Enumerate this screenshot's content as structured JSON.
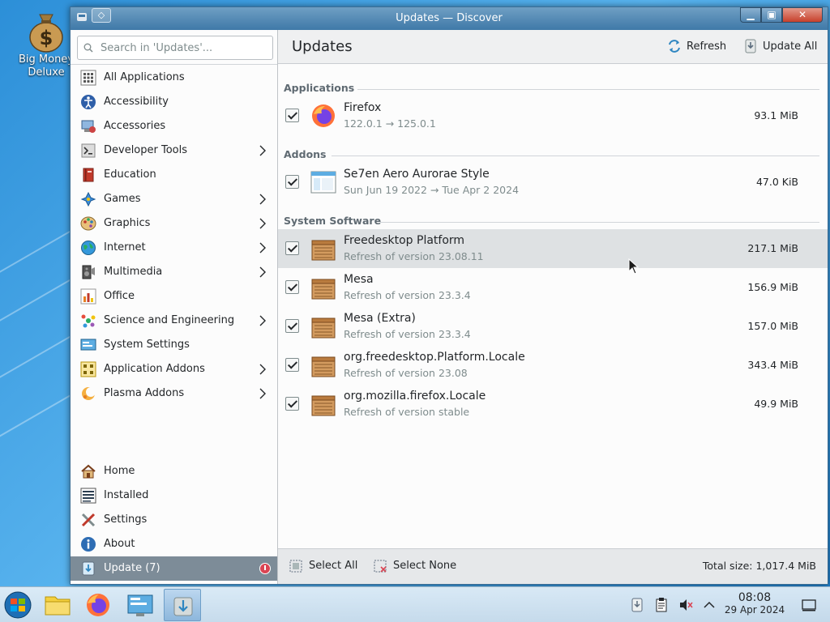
{
  "desktop": {
    "icon_label": "Big Money Deluxe"
  },
  "window": {
    "title": "Updates — Discover"
  },
  "sidebar": {
    "search_placeholder": "Search in 'Updates'...",
    "categories": [
      {
        "label": "All Applications",
        "has_children": false
      },
      {
        "label": "Accessibility",
        "has_children": false
      },
      {
        "label": "Accessories",
        "has_children": false
      },
      {
        "label": "Developer Tools",
        "has_children": true
      },
      {
        "label": "Education",
        "has_children": false
      },
      {
        "label": "Games",
        "has_children": true
      },
      {
        "label": "Graphics",
        "has_children": true
      },
      {
        "label": "Internet",
        "has_children": true
      },
      {
        "label": "Multimedia",
        "has_children": true
      },
      {
        "label": "Office",
        "has_children": false
      },
      {
        "label": "Science and Engineering",
        "has_children": true
      },
      {
        "label": "System Settings",
        "has_children": false
      },
      {
        "label": "Application Addons",
        "has_children": true
      },
      {
        "label": "Plasma Addons",
        "has_children": true
      }
    ],
    "nav": {
      "home": "Home",
      "installed": "Installed",
      "settings": "Settings",
      "about": "About",
      "update": "Update (7)"
    }
  },
  "header": {
    "title": "Updates",
    "refresh": "Refresh",
    "update_all": "Update All"
  },
  "sections": [
    {
      "title": "Applications",
      "items": [
        {
          "name": "Firefox",
          "desc": "122.0.1 → 125.0.1",
          "size": "93.1 MiB",
          "icon": "firefox-icon",
          "checked": true
        }
      ]
    },
    {
      "title": "Addons",
      "items": [
        {
          "name": "Se7en Aero Aurorae Style",
          "desc": "Sun Jun 19 2022 → Tue Apr 2 2024",
          "size": "47.0 KiB",
          "icon": "window-theme-icon",
          "checked": true
        }
      ]
    },
    {
      "title": "System Software",
      "items": [
        {
          "name": "Freedesktop Platform",
          "desc": "Refresh of version 23.08.11",
          "size": "217.1 MiB",
          "icon": "package-box-icon",
          "checked": true
        },
        {
          "name": "Mesa",
          "desc": "Refresh of version 23.3.4",
          "size": "156.9 MiB",
          "icon": "package-box-icon",
          "checked": true
        },
        {
          "name": "Mesa (Extra)",
          "desc": "Refresh of version 23.3.4",
          "size": "157.0 MiB",
          "icon": "package-box-icon",
          "checked": true
        },
        {
          "name": "org.freedesktop.Platform.Locale",
          "desc": "Refresh of version 23.08",
          "size": "343.4 MiB",
          "icon": "package-box-icon",
          "checked": true
        },
        {
          "name": "org.mozilla.firefox.Locale",
          "desc": "Refresh of version stable",
          "size": "49.9 MiB",
          "icon": "package-box-icon",
          "checked": true
        }
      ]
    }
  ],
  "footer": {
    "select_all": "Select All",
    "select_none": "Select None",
    "total": "Total size: 1,017.4 MiB"
  },
  "taskbar": {
    "time": "08:08",
    "date": "29 Apr 2024"
  },
  "colors": {
    "selection": "#dee1e3",
    "active_nav": "#7d8c98",
    "badge": "#da4453",
    "section_header": "#5f6a72"
  }
}
